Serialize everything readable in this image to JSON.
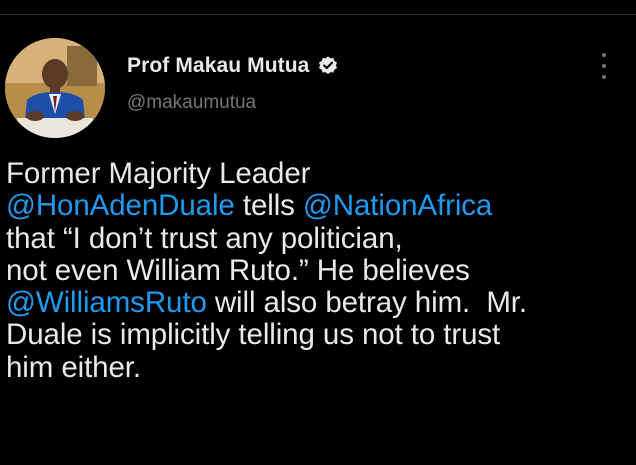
{
  "tweet": {
    "author": {
      "display_name": "Prof Makau Mutua",
      "handle": "@makaumutua",
      "verified": true,
      "avatar_description": "profile-photo"
    },
    "more_icon": "more-vertical-icon",
    "body_lines": [
      [
        {
          "text": "Former Majority Leader",
          "mention": false
        }
      ],
      [
        {
          "text": "@HonAdenDuale",
          "mention": true
        },
        {
          "text": " tells ",
          "mention": false
        },
        {
          "text": "@NationAfrica",
          "mention": true
        }
      ],
      [
        {
          "text": "that “I don’t trust any politician,",
          "mention": false
        }
      ],
      [
        {
          "text": "not even William Ruto.” He believes",
          "mention": false
        }
      ],
      [
        {
          "text": "@WilliamsRuto",
          "mention": true
        },
        {
          "text": " will also betray him.  Mr.",
          "mention": false
        }
      ],
      [
        {
          "text": "Duale is implicitly telling us not to trust",
          "mention": false
        }
      ],
      [
        {
          "text": "him either.",
          "mention": false
        }
      ]
    ]
  },
  "colors": {
    "background": "#000000",
    "text": "#e7e9ea",
    "secondary_text": "#71767b",
    "mention": "#1d9bf0",
    "divider": "#2f3336"
  }
}
